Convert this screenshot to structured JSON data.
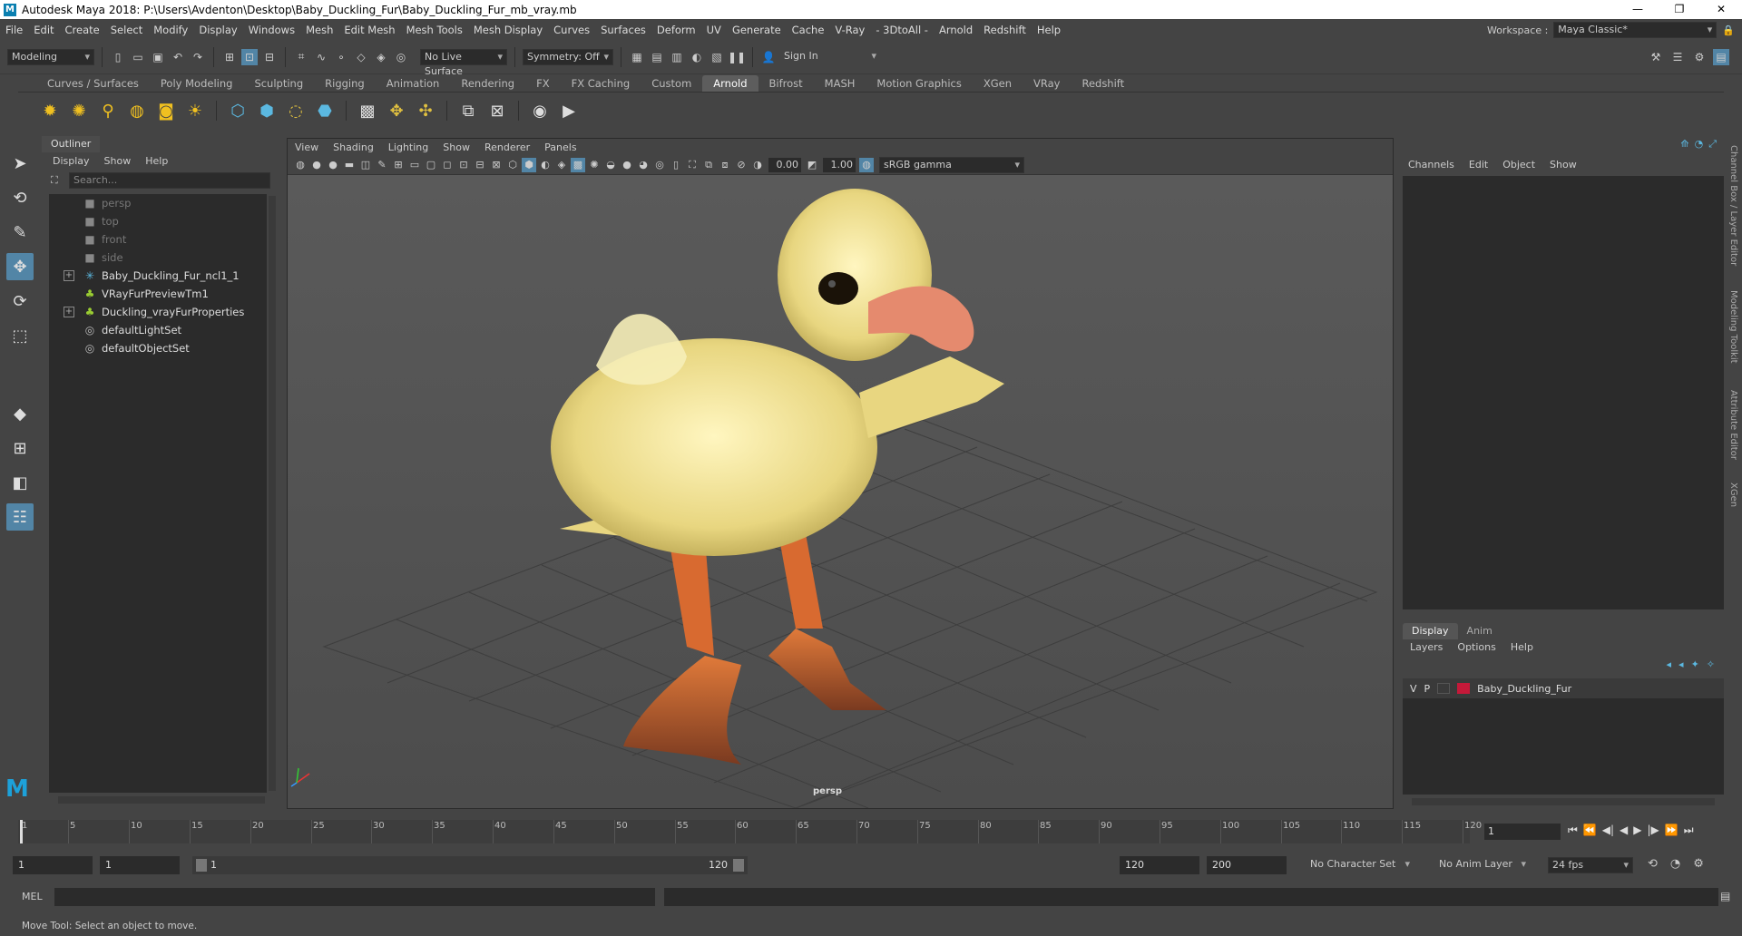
{
  "window": {
    "title": "Autodesk Maya 2018: P:\\Users\\Avdenton\\Desktop\\Baby_Duckling_Fur\\Baby_Duckling_Fur_mb_vray.mb",
    "min": "—",
    "max": "❐",
    "close": "✕"
  },
  "menus": [
    "File",
    "Edit",
    "Create",
    "Select",
    "Modify",
    "Display",
    "Windows",
    "Mesh",
    "Edit Mesh",
    "Mesh Tools",
    "Mesh Display",
    "Curves",
    "Surfaces",
    "Deform",
    "UV",
    "Generate",
    "Cache",
    "V-Ray",
    "- 3DtoAll -",
    "Arnold",
    "Redshift",
    "Help"
  ],
  "workspace": {
    "label": "Workspace :",
    "value": "Maya Classic*"
  },
  "status": {
    "mode": "Modeling",
    "live_surface": "No Live Surface",
    "symmetry": "Symmetry: Off",
    "sign_in": "Sign In"
  },
  "shelf_tabs": [
    "Curves / Surfaces",
    "Poly Modeling",
    "Sculpting",
    "Rigging",
    "Animation",
    "Rendering",
    "FX",
    "FX Caching",
    "Custom",
    "Arnold",
    "Bifrost",
    "MASH",
    "Motion Graphics",
    "XGen",
    "VRay",
    "Redshift"
  ],
  "shelf_active": "Arnold",
  "outliner": {
    "title": "Outliner",
    "menu": [
      "Display",
      "Show",
      "Help"
    ],
    "search_placeholder": "Search...",
    "items": [
      {
        "label": "persp",
        "icon": "camera-icon",
        "dim": true
      },
      {
        "label": "top",
        "icon": "camera-icon",
        "dim": true
      },
      {
        "label": "front",
        "icon": "camera-icon",
        "dim": true
      },
      {
        "label": "side",
        "icon": "camera-icon",
        "dim": true
      },
      {
        "label": "Baby_Duckling_Fur_ncl1_1",
        "icon": "nucleus-icon",
        "expand": true
      },
      {
        "label": "VRayFurPreviewTm1",
        "icon": "fur-icon"
      },
      {
        "label": "Duckling_vrayFurProperties",
        "icon": "fur-icon",
        "expand": true
      },
      {
        "label": "defaultLightSet",
        "icon": "set-icon"
      },
      {
        "label": "defaultObjectSet",
        "icon": "set-icon"
      }
    ]
  },
  "viewport": {
    "menu": [
      "View",
      "Shading",
      "Lighting",
      "Show",
      "Renderer",
      "Panels"
    ],
    "exposure": "0.00",
    "gamma": "1.00",
    "colorspace": "sRGB gamma",
    "camera_label": "persp"
  },
  "channelbox": {
    "menu": [
      "Channels",
      "Edit",
      "Object",
      "Show"
    ],
    "tabs": [
      "Display",
      "Anim"
    ],
    "layer_menu": [
      "Layers",
      "Options",
      "Help"
    ],
    "layer": {
      "v": "V",
      "p": "P",
      "name": "Baby_Duckling_Fur",
      "color": "#c41939"
    },
    "side_tabs": [
      "Channel Box / Layer Editor",
      "Modeling Toolkit",
      "Attribute Editor",
      "XGen"
    ]
  },
  "timeline": {
    "ticks": [
      "1",
      "5",
      "10",
      "15",
      "20",
      "25",
      "30",
      "35",
      "40",
      "45",
      "50",
      "55",
      "60",
      "65",
      "70",
      "75",
      "80",
      "85",
      "90",
      "95",
      "100",
      "105",
      "110",
      "115",
      "120"
    ],
    "current": "1"
  },
  "range": {
    "start": "1",
    "playback_start": "1",
    "slider_start": "1",
    "slider_end": "120",
    "playback_end": "120",
    "end": "200",
    "char_set": "No Character Set",
    "anim_layer": "No Anim Layer",
    "fps": "24 fps"
  },
  "cmd": {
    "lang": "MEL"
  },
  "help": "Move Tool: Select an object to move."
}
